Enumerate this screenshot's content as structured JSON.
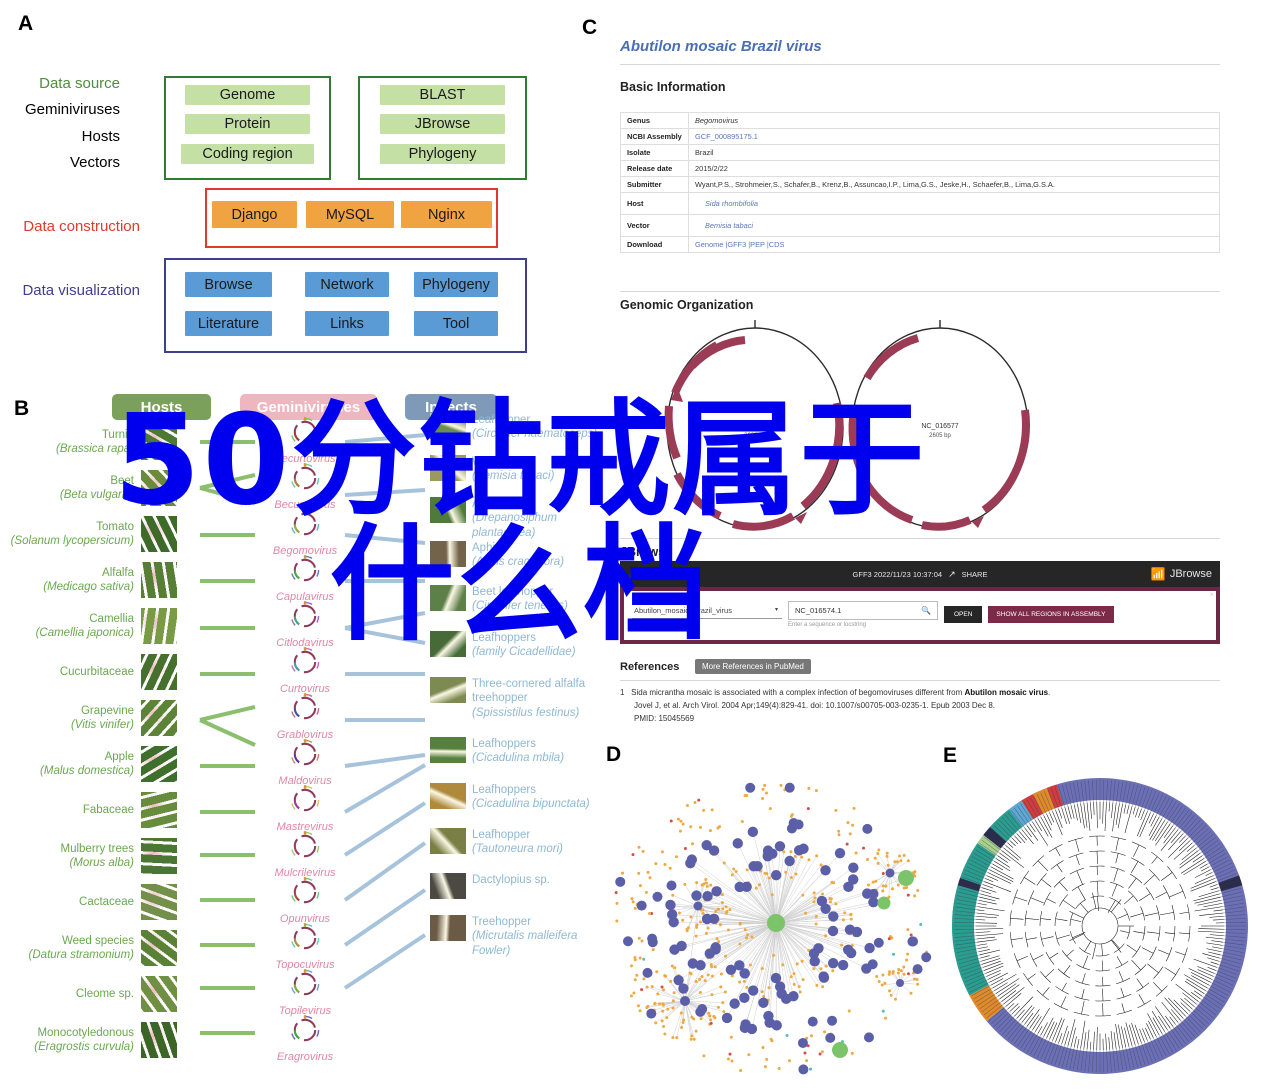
{
  "panels": {
    "a": "A",
    "b": "B",
    "c": "C",
    "d": "D",
    "e": "E"
  },
  "watermark": {
    "line1": "50分钻戒属于",
    "line2": "什么档",
    "color": "#0000ee"
  },
  "architecture": {
    "rows": [
      {
        "label": "Data source",
        "color": "#4e8c3f"
      },
      {
        "label": "Geminiviruses",
        "color": "#1a1a1a"
      },
      {
        "label": "Hosts",
        "color": "#1a1a1a"
      },
      {
        "label": "Vectors",
        "color": "#1a1a1a"
      },
      {
        "label": "Data construction",
        "color": "#e03a2f"
      },
      {
        "label": "Data visualization",
        "color": "#3f3f8f"
      }
    ],
    "source_box_left": {
      "border_color": "#2f7d32",
      "items": [
        "Genome",
        "Protein",
        "Coding region"
      ]
    },
    "source_box_right": {
      "border_color": "#2f7d32",
      "items": [
        "BLAST",
        "JBrowse",
        "Phylogeny"
      ]
    },
    "construction_box": {
      "border_color": "#e03a2f",
      "items": [
        "Django",
        "MySQL",
        "Nginx"
      ]
    },
    "visualization_box": {
      "border_color": "#3f3f8f",
      "items": [
        "Browse",
        "Network",
        "Phylogeny",
        "Literature",
        "Links",
        "Tool"
      ]
    },
    "chip_colors": {
      "source": "#c5e0a5",
      "construction": "#f0a341",
      "visualization": "#5b9bd5"
    }
  },
  "tripartite": {
    "headers": [
      {
        "label": "Hosts",
        "color": "#7ba05b"
      },
      {
        "label": "Geminiviruses",
        "color": "#eeb6bf"
      },
      {
        "label": "Insects",
        "color": "#7e9ab8"
      }
    ],
    "hosts": [
      {
        "common": "Turnip",
        "latin": "(Brassica rapa)"
      },
      {
        "common": "Beet",
        "latin": "(Beta vulgaris)"
      },
      {
        "common": "Tomato",
        "latin": "(Solanum lycopersicum)"
      },
      {
        "common": "Alfalfa",
        "latin": "(Medicago sativa)"
      },
      {
        "common": "Camellia",
        "latin": "(Camellia japonica)"
      },
      {
        "common": "Cucurbitaceae",
        "latin": ""
      },
      {
        "common": "Grapevine",
        "latin": "(Vitis vinifer)"
      },
      {
        "common": "Apple",
        "latin": "(Malus domestica)"
      },
      {
        "common": "Fabaceae",
        "latin": ""
      },
      {
        "common": "Mulberry trees",
        "latin": "(Morus alba)"
      },
      {
        "common": "Cactaceae",
        "latin": ""
      },
      {
        "common": "Weed species",
        "latin": "(Datura stramonium)"
      },
      {
        "common": "Cleome sp.",
        "latin": ""
      },
      {
        "common": "Monocotyledonous",
        "latin": "(Eragrostis curvula)"
      }
    ],
    "genera": [
      "Becurtovirus",
      "Becurtovirus",
      "Begomovirus",
      "Capulavirus",
      "Citlodavirus",
      "Curtovirus",
      "Grablovirus",
      "Maldovirus",
      "Mastrevirus",
      "Mulcrilevirus",
      "Opunvirus",
      "Topocuvirus",
      "Topilevirus",
      "Eragrovirus"
    ],
    "insects": [
      {
        "common": "Leafhopper",
        "latin": "(Circulifer haematoceps)"
      },
      {
        "common": "Whitefly",
        "latin": "(Bemisia tabaci)"
      },
      {
        "common": "Aphid",
        "latin": "(Drepanosiphum plantaginea)"
      },
      {
        "common": "Aphid",
        "latin": "(Aphis craccivora)"
      },
      {
        "common": "Beet leafhopper",
        "latin": "(Circulifer tenellus)"
      },
      {
        "common": "Leafhoppers",
        "latin": "(family Cicadellidae)"
      },
      {
        "common": "Three-cornered alfalfa treehopper",
        "latin": "(Spissistilus festinus)"
      },
      {
        "common": "Leafhoppers",
        "latin": "(Cicadulina mbila)"
      },
      {
        "common": "Leafhoppers",
        "latin": "(Cicadulina bipunctata)"
      },
      {
        "common": "Leafhopper",
        "latin": "(Tautoneura mori)"
      },
      {
        "common": "Dactylopius sp.",
        "latin": ""
      },
      {
        "common": "Treehopper",
        "latin": "(Micrutalis malleifera Fowler)"
      }
    ]
  },
  "virus_page": {
    "title": "Abutilon mosaic Brazil virus",
    "basic_information_heading": "Basic Information",
    "table": [
      {
        "key": "Genus",
        "value": "Begomovirus",
        "style": "italic"
      },
      {
        "key": "NCBI Assembly",
        "value": "GCF_000895175.1",
        "style": "link"
      },
      {
        "key": "Isolate",
        "value": "Brazil",
        "style": "plain"
      },
      {
        "key": "Release date",
        "value": "2015/2/22",
        "style": "plain"
      },
      {
        "key": "Submitter",
        "value": "Wyant,P.S., Strohmeier,S., Schafer,B., Krenz,B., Assuncao,I.P., Lima,G.S., Jeske,H., Schaefer,B., Lima,G.S.A.",
        "style": "plain"
      },
      {
        "key": "Host",
        "value": "Sida rhombifolia",
        "style": "link-italic"
      },
      {
        "key": "Vector",
        "value": "Bemisia tabaci",
        "style": "link-italic"
      },
      {
        "key": "Download",
        "value": "Genome |GFF3 |PEP |CDS",
        "style": "link"
      }
    ],
    "genomic_organization_heading": "Genomic Organization",
    "genome_circles": [
      {
        "accession": "NC_016574",
        "length": "2632 bp"
      },
      {
        "accession": "NC_016577",
        "length": "2605 bp"
      }
    ],
    "jbrowse_heading": "JBrowse",
    "jbrowse": {
      "menu": [
        "FILE",
        "HELP"
      ],
      "status": "GFF3 2022/11/23 10:37:04",
      "share_label": "SHARE",
      "brand": "JBrowse",
      "assembly_value": "Abutilon_mosaic_Brazil_virus",
      "assembly_hint": "Select assembly to view",
      "search_value": "NC_016574.1",
      "search_hint": "Enter a sequence or locstring",
      "open_button": "OPEN",
      "regions_button": "SHOW ALL REGIONS IN ASSEMBLY",
      "close_label": "×"
    },
    "references": {
      "heading": "References",
      "more_button": "More References in PubMed",
      "entries": [
        {
          "index": "1",
          "title_prefix": "Sida micrantha mosaic is associated with a complex infection of begomoviruses different from ",
          "title_bold": "Abutilon mosaic virus",
          "title_suffix": ".",
          "citation": "Jovel J, et al. Arch Virol. 2004 Apr;149(4):829-41. doi: 10.1007/s00705-003-0235-1. Epub 2003 Dec 8.",
          "pmid": "PMID: 15045569"
        }
      ]
    }
  },
  "network": {
    "caption": "D",
    "node_colors": {
      "virus": "#5b5fa8",
      "small_link": "#f0a841",
      "highlight": "#7cc46a",
      "alert": "#d94b4b",
      "teal": "#57bcc0"
    }
  },
  "phylogeny": {
    "caption": "E",
    "ring_colors": {
      "primary": "#6b70b5",
      "teal": "#2a9d8f",
      "orange": "#e08b2a",
      "red": "#d13c3c",
      "lightblue": "#5fa8d3",
      "lightgreen": "#a8d08d",
      "dark": "#2b2b4a"
    }
  }
}
